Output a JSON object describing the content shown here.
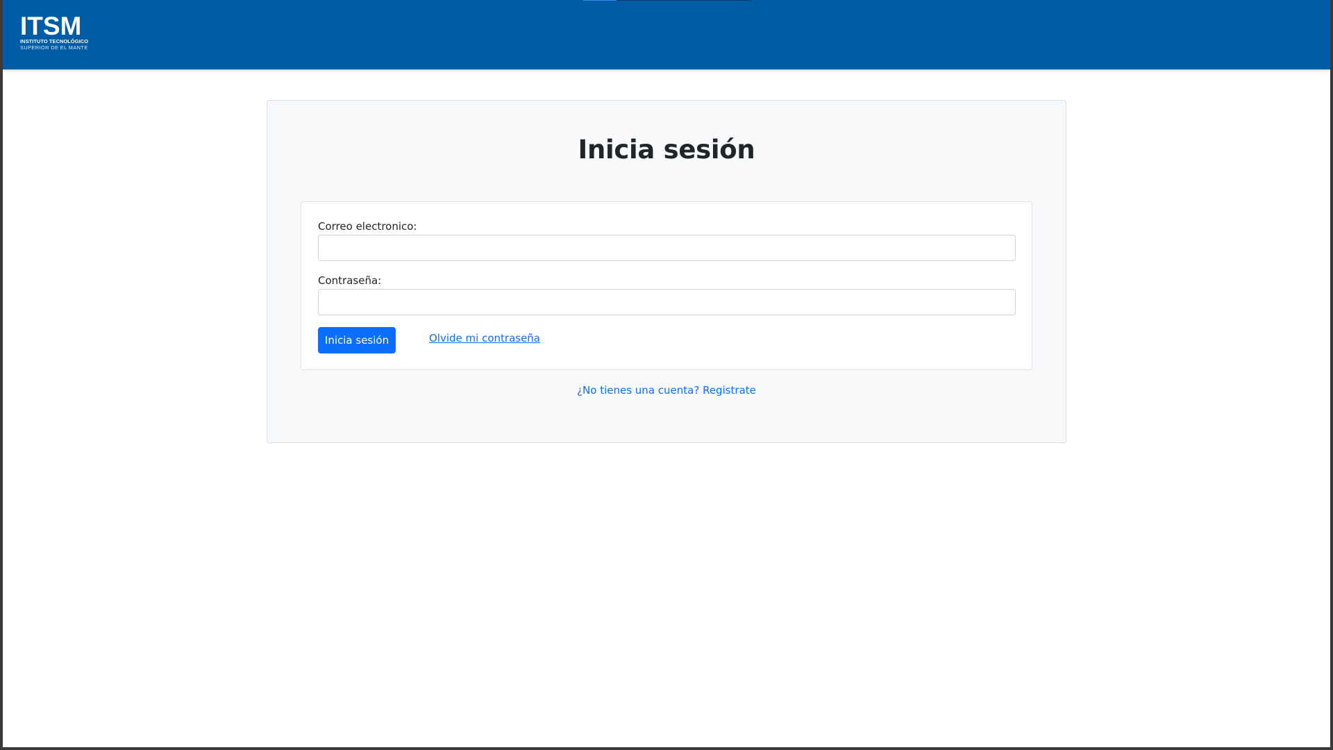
{
  "header": {
    "logo": {
      "main": "ITSM",
      "line1": "INSTITUTO TECNOLÓGICO",
      "line2": "SUPERIOR DE EL MANTE"
    },
    "background_color": "#005ca5"
  },
  "login": {
    "title": "Inicia sesión",
    "email_label": "Correo electronico:",
    "email_value": "",
    "password_label": "Contraseña:",
    "password_value": "",
    "submit_label": "Inicia sesión",
    "forgot_link": "Olvide mi contraseña",
    "register_link": "¿No tienes una cuenta? Registrate"
  },
  "colors": {
    "primary": "#0d6efd",
    "text": "#212529",
    "card_background": "#f8f9fa"
  }
}
